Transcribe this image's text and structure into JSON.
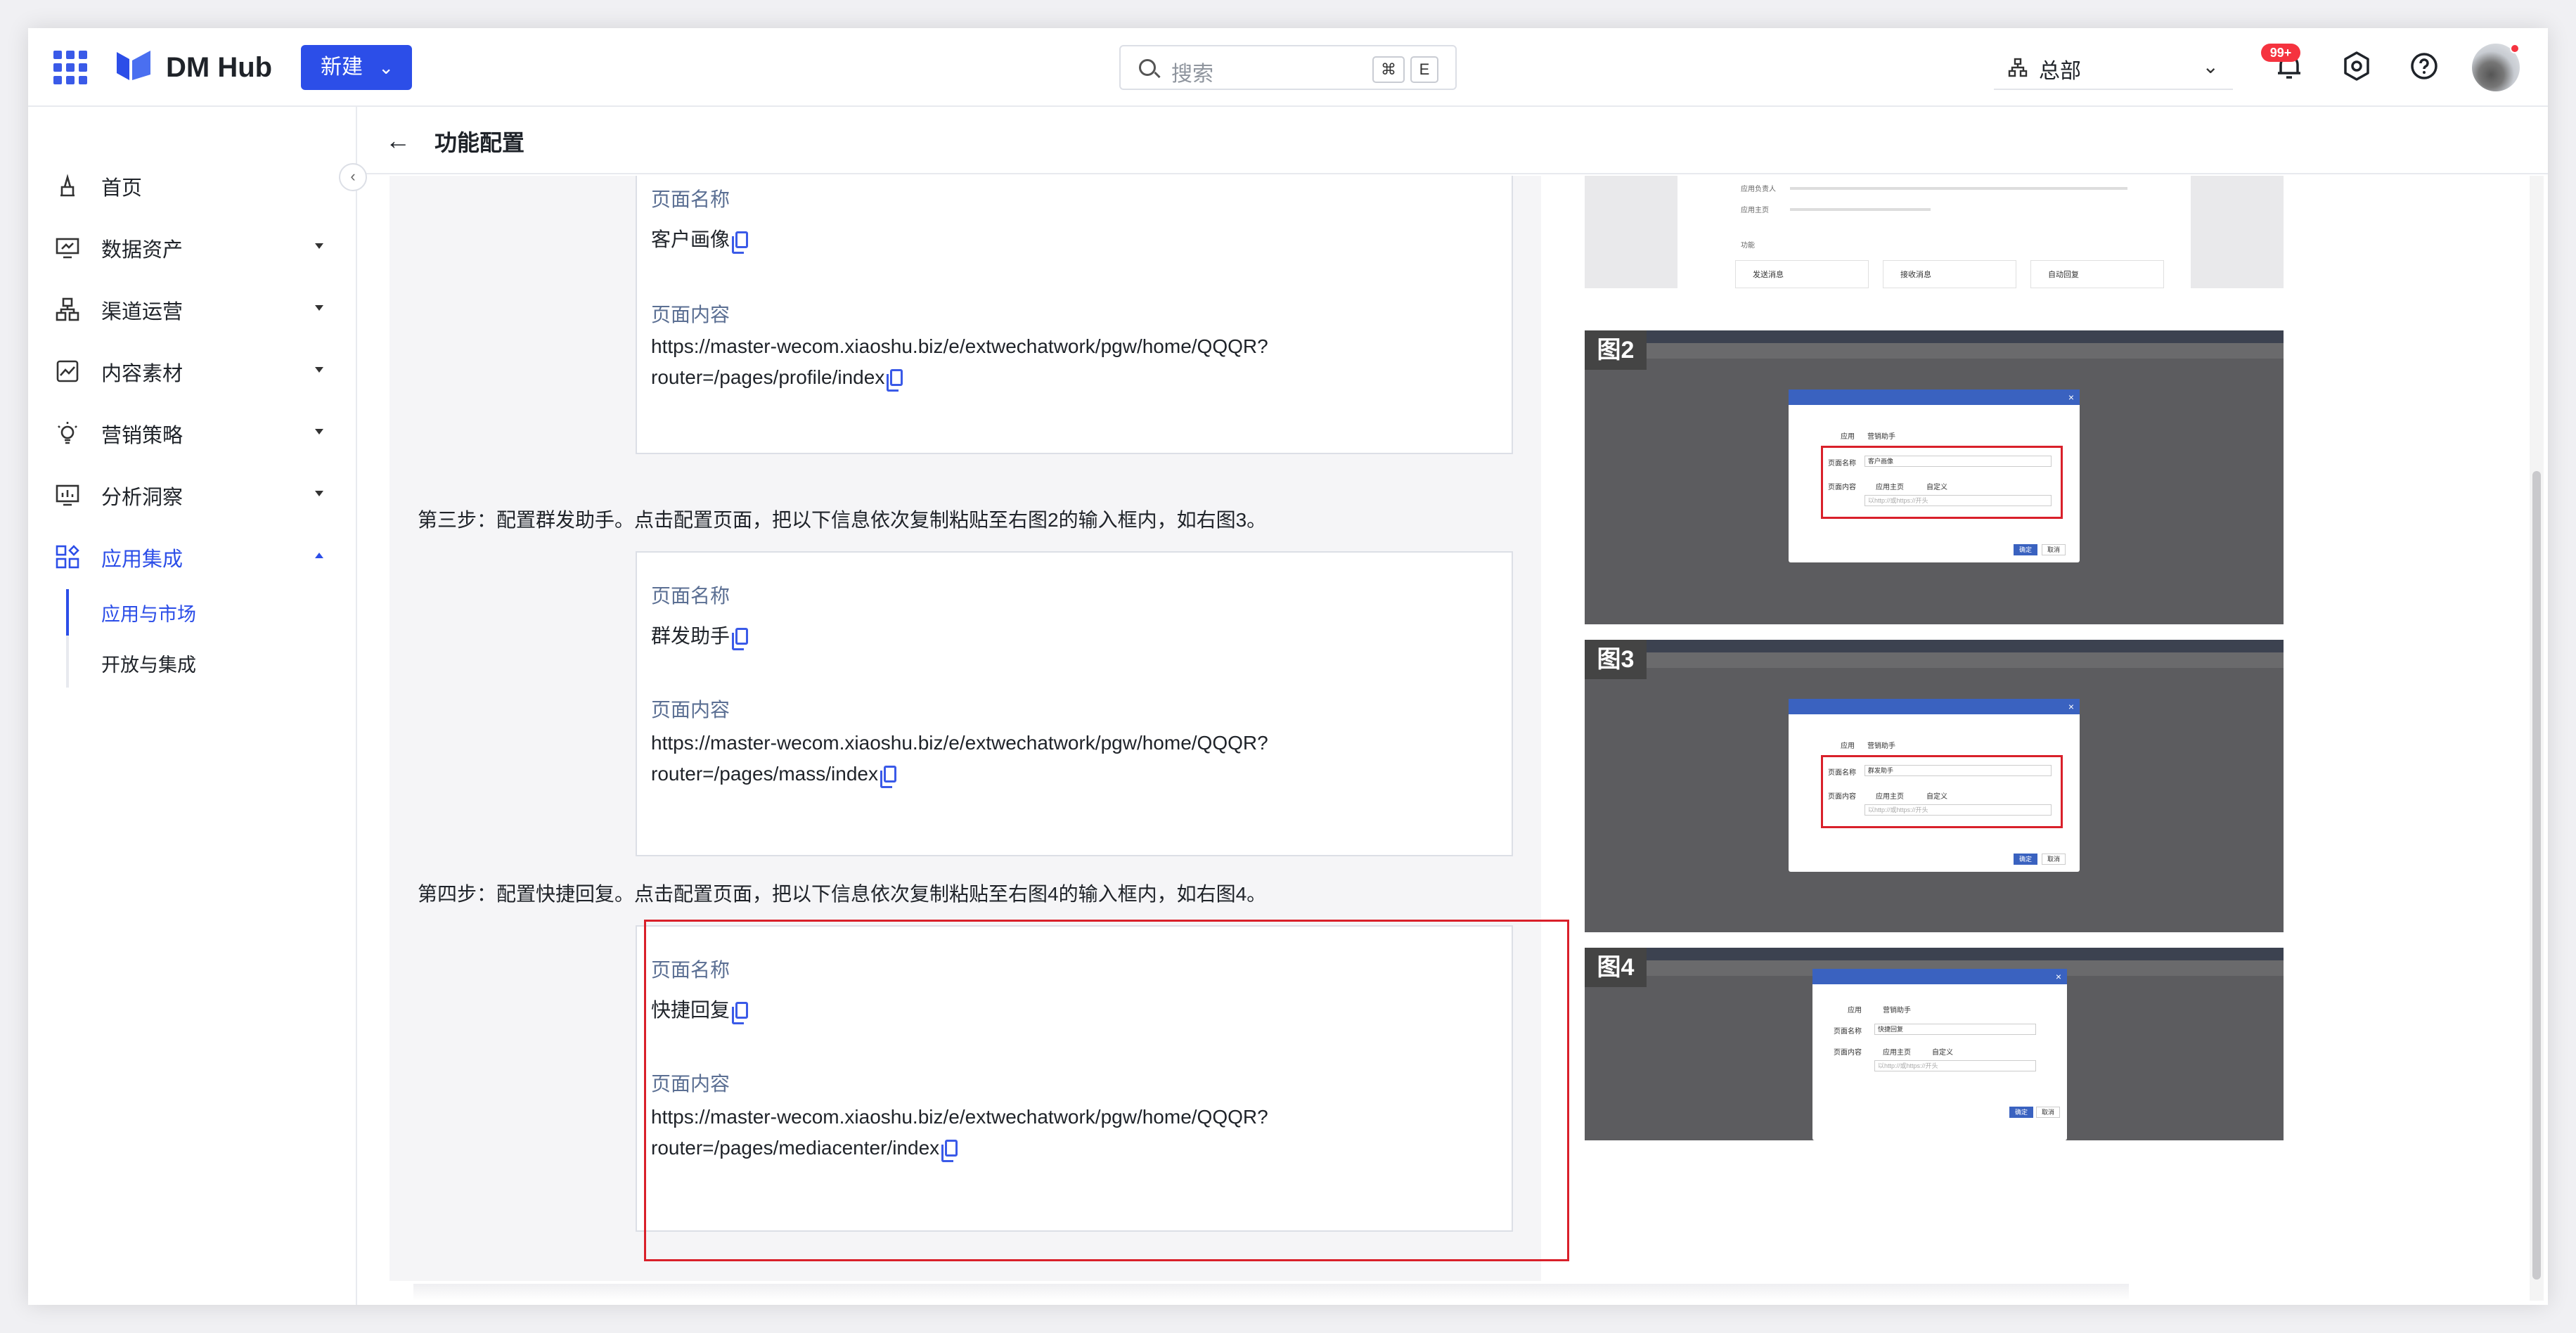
{
  "topbar": {
    "brand": "DM Hub",
    "new_label": "新建",
    "search_placeholder": "搜索",
    "shortcut_mod": "⌘",
    "shortcut_key": "E",
    "department": "总部",
    "notification_badge": "99+"
  },
  "sidebar": {
    "items": [
      {
        "label": "首页",
        "icon": "home-icon"
      },
      {
        "label": "数据资产",
        "icon": "data-asset-icon"
      },
      {
        "label": "渠道运营",
        "icon": "channel-icon"
      },
      {
        "label": "内容素材",
        "icon": "content-icon"
      },
      {
        "label": "营销策略",
        "icon": "strategy-icon"
      },
      {
        "label": "分析洞察",
        "icon": "analytics-icon"
      },
      {
        "label": "应用集成",
        "icon": "app-integration-icon"
      }
    ],
    "sub_items": [
      {
        "label": "应用与市场"
      },
      {
        "label": "开放与集成"
      }
    ]
  },
  "page": {
    "title": "功能配置"
  },
  "content": {
    "card1": {
      "name_key": "页面名称",
      "name_value": "客户画像",
      "content_key": "页面内容",
      "content_line1": "https://master-wecom.xiaoshu.biz/e/extwechatwork/pgw/home/QQQR?",
      "content_line2": "router=/pages/profile/index"
    },
    "step3": "第三步：配置群发助手。点击配置页面，把以下信息依次复制粘贴至右图2的输入框内，如右图3。",
    "card2": {
      "name_key": "页面名称",
      "name_value": "群发助手",
      "content_key": "页面内容",
      "content_line1": "https://master-wecom.xiaoshu.biz/e/extwechatwork/pgw/home/QQQR?",
      "content_line2": "router=/pages/mass/index"
    },
    "step4": "第四步：配置快捷回复。点击配置页面，把以下信息依次复制粘贴至右图4的输入框内，如右图4。",
    "card3": {
      "name_key": "页面名称",
      "name_value": "快捷回复",
      "content_key": "页面内容",
      "content_line1": "https://master-wecom.xiaoshu.biz/e/extwechatwork/pgw/home/QQQR?",
      "content_line2": "router=/pages/mediacenter/index"
    }
  },
  "figures": {
    "fig1": {
      "row1_key": "应用负责人",
      "row2_key": "应用主页",
      "section": "功能",
      "btn1": "发送消息",
      "btn2": "接收消息",
      "btn3": "自动回复"
    },
    "fig2": {
      "tag": "图2",
      "app_label": "应用",
      "app_name": "营销助手",
      "name_label": "页面名称",
      "name_value": "客户画像",
      "content_label": "页面内容",
      "opt1": "应用主页",
      "opt2": "自定义",
      "url_placeholder": "以http://或https://开头",
      "ok": "确定",
      "cancel": "取消"
    },
    "fig3": {
      "tag": "图3",
      "app_label": "应用",
      "app_name": "营销助手",
      "name_label": "页面名称",
      "name_value": "群发助手",
      "content_label": "页面内容",
      "opt1": "应用主页",
      "opt2": "自定义",
      "url_placeholder": "以http://或https://开头",
      "ok": "确定",
      "cancel": "取消"
    },
    "fig4": {
      "tag": "图4",
      "app_label": "应用",
      "app_name": "营销助手",
      "name_label": "页面名称",
      "name_value": "快捷回复",
      "content_label": "页面内容",
      "opt1": "应用主页",
      "opt2": "自定义",
      "url_placeholder": "以http://或https://开头",
      "ok": "确定",
      "cancel": "取消"
    }
  },
  "colors": {
    "accent": "#2c4ee8",
    "highlight_border": "#d9202a",
    "badge": "#f5333f"
  }
}
